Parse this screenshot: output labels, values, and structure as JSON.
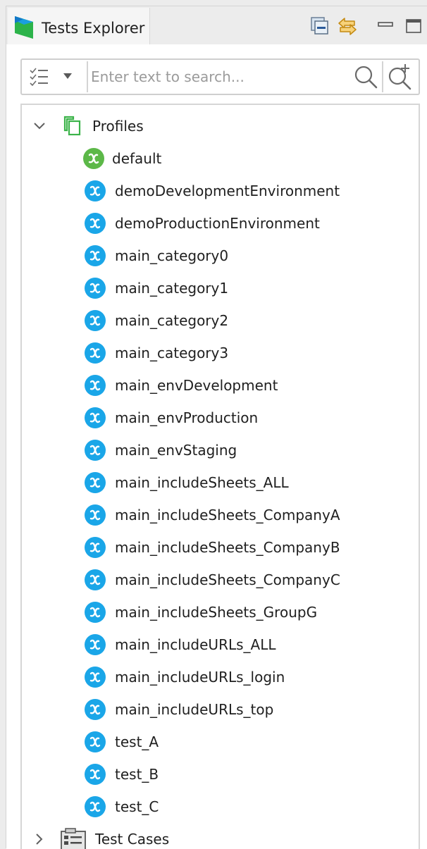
{
  "tab": {
    "title": "Tests Explorer"
  },
  "toolbar": {
    "collapse_icon": "collapse-all-icon",
    "link_icon": "link-with-editor-icon",
    "minimize_icon": "minimize-icon",
    "maximize_icon": "maximize-icon"
  },
  "filter": {
    "placeholder": "Enter text to search...",
    "value": ""
  },
  "tree": {
    "profiles_label": "Profiles",
    "profiles": [
      {
        "label": "default",
        "color": "#5cb848"
      },
      {
        "label": "demoDevelopmentEnvironment",
        "color": "#1aa6e8"
      },
      {
        "label": "demoProductionEnvironment",
        "color": "#1aa6e8"
      },
      {
        "label": "main_category0",
        "color": "#1aa6e8"
      },
      {
        "label": "main_category1",
        "color": "#1aa6e8"
      },
      {
        "label": "main_category2",
        "color": "#1aa6e8"
      },
      {
        "label": "main_category3",
        "color": "#1aa6e8"
      },
      {
        "label": "main_envDevelopment",
        "color": "#1aa6e8"
      },
      {
        "label": "main_envProduction",
        "color": "#1aa6e8"
      },
      {
        "label": "main_envStaging",
        "color": "#1aa6e8"
      },
      {
        "label": "main_includeSheets_ALL",
        "color": "#1aa6e8"
      },
      {
        "label": "main_includeSheets_CompanyA",
        "color": "#1aa6e8"
      },
      {
        "label": "main_includeSheets_CompanyB",
        "color": "#1aa6e8"
      },
      {
        "label": "main_includeSheets_CompanyC",
        "color": "#1aa6e8"
      },
      {
        "label": "main_includeSheets_GroupG",
        "color": "#1aa6e8"
      },
      {
        "label": "main_includeURLs_ALL",
        "color": "#1aa6e8"
      },
      {
        "label": "main_includeURLs_login",
        "color": "#1aa6e8"
      },
      {
        "label": "main_includeURLs_top",
        "color": "#1aa6e8"
      },
      {
        "label": "test_A",
        "color": "#1aa6e8"
      },
      {
        "label": "test_B",
        "color": "#1aa6e8"
      },
      {
        "label": "test_C",
        "color": "#1aa6e8"
      }
    ],
    "test_cases_label": "Test Cases"
  },
  "colors": {
    "accent_green": "#3cb34a",
    "accent_blue": "#1aa6e8",
    "link_orange": "#e0a321"
  }
}
